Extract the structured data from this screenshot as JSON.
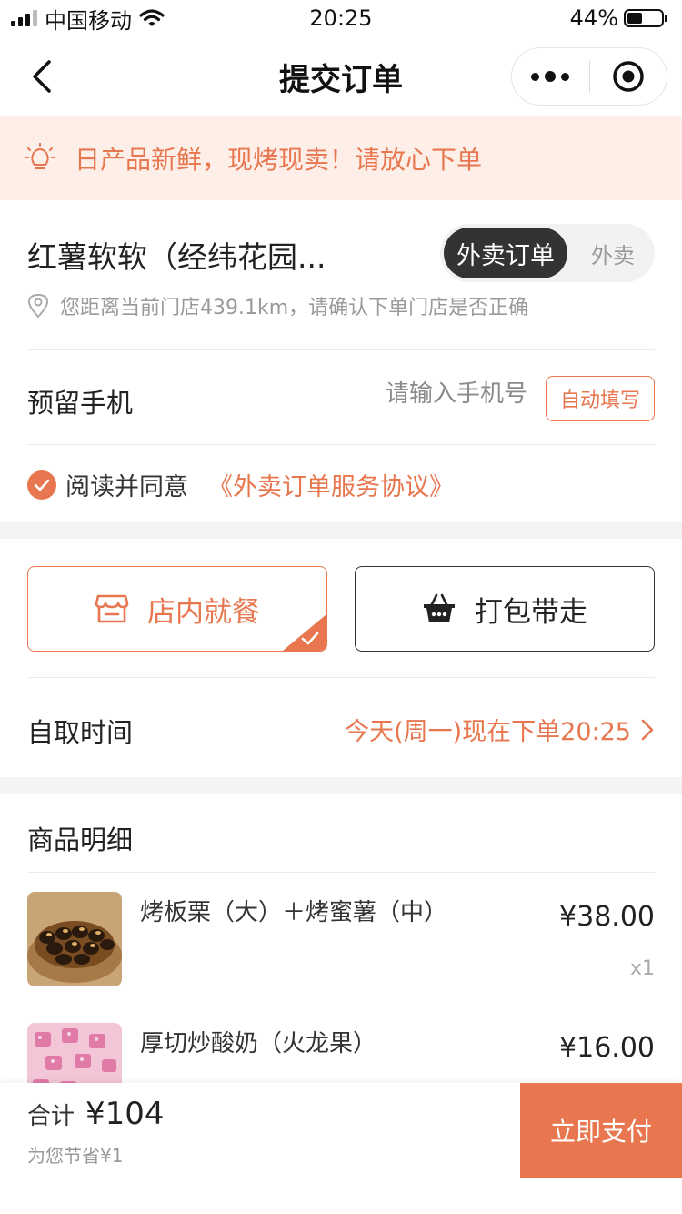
{
  "status_bar": {
    "carrier": "中国移动",
    "time": "20:25",
    "battery": "44%",
    "battery_level": 0.44
  },
  "nav": {
    "title": "提交订单",
    "back_icon": "chevron-left-icon",
    "more_icon": "more-dots-icon",
    "close_icon": "target-circle-icon"
  },
  "notice": {
    "icon": "lightbulb-icon",
    "text": "日产品新鲜，现烤现卖！请放心下单"
  },
  "store": {
    "name": "红薯软软（经纬花园...",
    "mode_active": "外卖订单",
    "mode_inactive": "外卖",
    "distance_icon": "location-pin-icon",
    "distance_text": "您距离当前门店439.1km，请确认下单门店是否正确"
  },
  "phone": {
    "label": "预留手机",
    "placeholder": "请输入手机号",
    "value": "",
    "autofill_label": "自动填写"
  },
  "agreement": {
    "text": "阅读并同意",
    "link": "《外卖订单服务协议》"
  },
  "dining": {
    "dine_in": "店内就餐",
    "takeaway": "打包带走",
    "selected": "dine_in"
  },
  "pickup": {
    "label": "自取时间",
    "value": "今天(周一)现在下单20:25"
  },
  "goods": {
    "title": "商品明细",
    "items": [
      {
        "name": "烤板栗（大）＋烤蜜薯（中）",
        "price": "¥38.00",
        "qty": "x1"
      },
      {
        "name": "厚切炒酸奶（火龙果）",
        "price": "¥16.00",
        "qty": ""
      }
    ]
  },
  "footer": {
    "total_label": "合计",
    "total_amount": "¥104",
    "saved_text": "为您节省¥1",
    "pay_label": "立即支付"
  },
  "colors": {
    "accent": "#e8774f",
    "notice_bg": "#fdeee7",
    "dark": "#333333"
  }
}
